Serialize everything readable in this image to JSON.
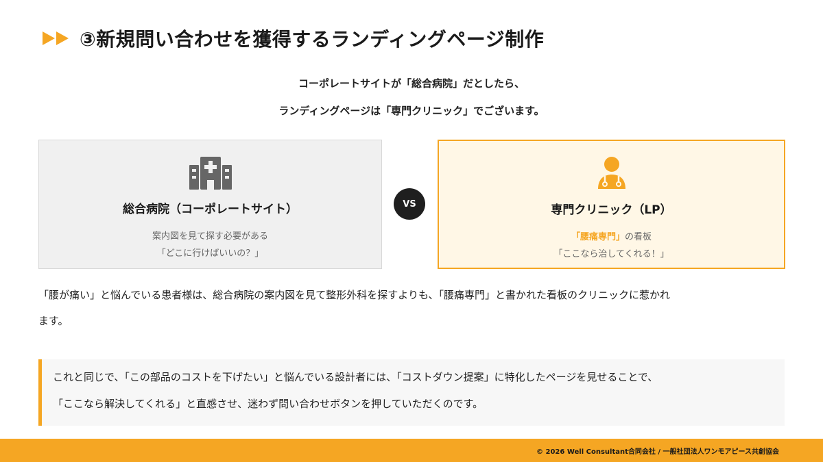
{
  "header": {
    "title": "③新規問い合わせを獲得するランディングページ制作",
    "icon": "double-play-icon",
    "accent_color": "#f5a623"
  },
  "intro": {
    "line1": "コーポレートサイトが「総合病院」だとしたら、",
    "line2": "ランディングページは「専門クリニック」でございます。"
  },
  "comparison": {
    "left": {
      "icon": "hospital-building-icon",
      "title": "総合病院（コーポレートサイト）",
      "line1": "案内図を見て探す必要がある",
      "line2": "「どこに行けばいいの？」"
    },
    "vs_label": "VS",
    "right": {
      "icon": "doctor-icon",
      "title": "専門クリニック（LP）",
      "line1_highlight": "「腰痛専門」",
      "line1_rest": "の看板",
      "line2": "「ここなら治してくれる！」"
    }
  },
  "explanation": {
    "line1": "「腰が痛い」と悩んでいる患者様は、総合病院の案内図を見て整形外科を探すよりも、「腰痛専門」と書かれた看板のクリニックに惹かれ",
    "line2": "ます。"
  },
  "callout": {
    "line1": "これと同じで、「この部品のコストを下げたい」と悩んでいる設計者には、「コストダウン提案」に特化したページを見せることで、",
    "line2": "「ここなら解決してくれる」と直感させ、迷わず問い合わせボタンを押していただくのです。"
  },
  "footer": {
    "copyright": "© 2026 Well Consultant合同会社 / 一般社団法人ワンモアピース共創協会"
  }
}
